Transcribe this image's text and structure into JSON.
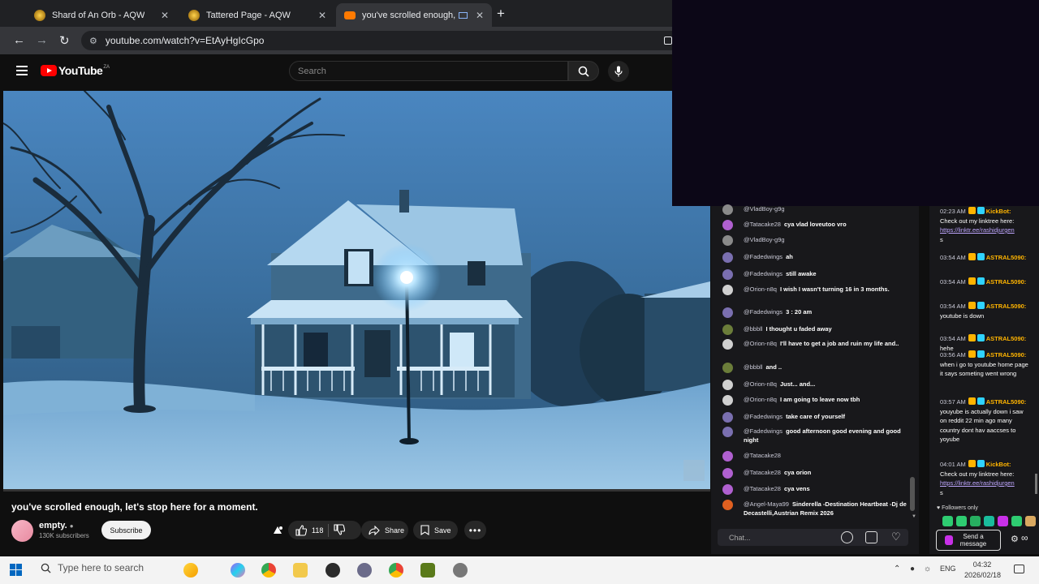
{
  "browser": {
    "tabs": [
      {
        "title": "Shard of An Orb - AQW",
        "close": "✕"
      },
      {
        "title": "Tattered Page - AQW",
        "close": "✕"
      },
      {
        "title": "you've scrolled enough, let",
        "close": "✕",
        "active": true
      }
    ],
    "new_tab": "+",
    "url": "youtube.com/watch?v=EtAyHgIcGpo"
  },
  "youtube": {
    "logo": "YouTube",
    "country": "ZA",
    "search_placeholder": "Search",
    "video_title": "you've scrolled enough, let's stop here for a moment.",
    "channel_name": "empty.",
    "subscribers": "130K subscribers",
    "subscribe_label": "Subscribe",
    "like_count": "118",
    "share_label": "Share",
    "save_label": "Save"
  },
  "chat": {
    "messages": [
      {
        "user": "@VladBoy-g9g",
        "text": "",
        "avatar_color": "#8a8a8a"
      },
      {
        "user": "@Tatacake28",
        "text": "cya vlad loveutoo vro",
        "avatar_color": "#b060d0"
      },
      {
        "user": "@VladBoy-g9g",
        "text": "",
        "avatar_color": "#8a8a8a"
      },
      {
        "user": "@Fadedwings",
        "text": "ah",
        "avatar_color": "#7a6fb0"
      },
      {
        "user": "@Fadedwings",
        "text": "still awake",
        "avatar_color": "#7a6fb0"
      },
      {
        "user": "@Orion-n8q",
        "text": "I wish I wasn't turning 16 in 3 months.",
        "avatar_color": "#d0d0d0"
      },
      {
        "user": "@Fadedwings",
        "text": "3 : 20 am",
        "avatar_color": "#7a6fb0"
      },
      {
        "user": "@bbbll",
        "text": "I thought u faded away",
        "avatar_color": "#6b7d3a"
      },
      {
        "user": "@Orion-n8q",
        "text": "I'll have to get a job and ruin my life and..",
        "avatar_color": "#d0d0d0"
      },
      {
        "user": "@bbbll",
        "text": "and ..",
        "avatar_color": "#6b7d3a"
      },
      {
        "user": "@Orion-n8q",
        "text": "Just... and...",
        "avatar_color": "#d0d0d0"
      },
      {
        "user": "@Orion-n8q",
        "text": "I am going to leave now tbh",
        "avatar_color": "#d0d0d0"
      },
      {
        "user": "@Fadedwings",
        "text": "take care of yourself",
        "avatar_color": "#7a6fb0"
      },
      {
        "user": "@Fadedwings",
        "text": "good afternoon good evening and good night",
        "avatar_color": "#7a6fb0"
      },
      {
        "user": "@Tatacake28",
        "text": "",
        "avatar_color": "#b060d0"
      },
      {
        "user": "@Tatacake28",
        "text": "cya orion",
        "avatar_color": "#b060d0"
      },
      {
        "user": "@Tatacake28",
        "text": "cya vens",
        "avatar_color": "#b060d0"
      },
      {
        "user": "@Angel-Maya99",
        "text": "Sinderella -Destination Heartbeat -Dj de Decastelli,Austrian Remix 2026",
        "avatar_color": "#e06020"
      }
    ],
    "input_placeholder": "Chat..."
  },
  "chat2": {
    "messages": [
      {
        "time": "02:23 AM",
        "name": "KickBot:",
        "name_color": "#ffb400",
        "text": "Check out my linktree here:",
        "link": "https://linktr.ee/rashidjurgen",
        "tail": "s"
      },
      {
        "time": "03:54 AM",
        "name": "ASTRAL5090:",
        "name_color": "#ffb400",
        "text": ""
      },
      {
        "time": "03:54 AM",
        "name": "ASTRAL5090:",
        "name_color": "#ffb400",
        "text": ""
      },
      {
        "time": "03:54 AM",
        "name": "ASTRAL5090:",
        "name_color": "#ffb400",
        "text": "youtube is down"
      },
      {
        "time": "03:54 AM",
        "name": "ASTRAL5090:",
        "name_color": "#ffb400",
        "text": "hehe"
      },
      {
        "time": "03:56 AM",
        "name": "ASTRAL5090:",
        "name_color": "#ffb400",
        "text": "when i go to youtube home page it says someting went wrong"
      },
      {
        "time": "03:57 AM",
        "name": "ASTRAL5090:",
        "name_color": "#ffb400",
        "text": "youyube is actually down i saw on reddit 22 min ago many country dont hav aaccses to yoyube"
      },
      {
        "time": "04:01 AM",
        "name": "KickBot:",
        "name_color": "#ffb400",
        "text": "Check out my linktree here:",
        "link": "https://linktr.ee/rashidjurgen",
        "tail": "s"
      }
    ],
    "followers_only": "Followers only",
    "send_label": "Send a message"
  },
  "taskbar": {
    "search_placeholder": "Type here to search",
    "language": "ENG",
    "time": "04:32",
    "date": "2026/02/18"
  },
  "colors": {
    "page_bg": "#0f0f0f",
    "chat_bg": "#18181b",
    "overlay_bg": "#0c0717",
    "youtube_red": "#ff0000"
  }
}
